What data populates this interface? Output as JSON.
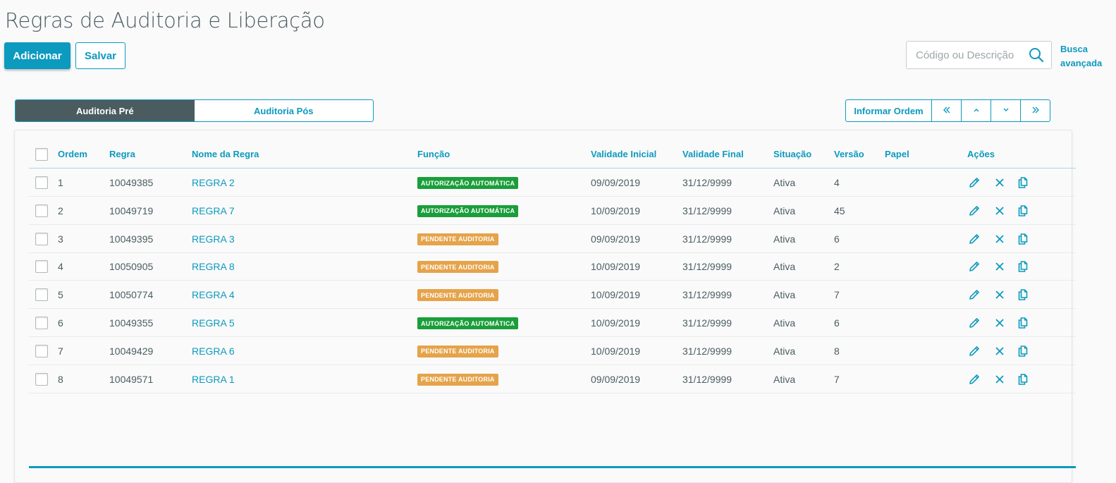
{
  "page": {
    "title": "Regras de Auditoria e Liberação"
  },
  "toolbar": {
    "add_label": "Adicionar",
    "save_label": "Salvar"
  },
  "search": {
    "placeholder": "Código ou Descrição",
    "value": "",
    "advanced_line1": "Busca",
    "advanced_line2": "avançada"
  },
  "tabs": [
    {
      "label": "Auditoria Pré",
      "active": true
    },
    {
      "label": "Auditoria Pós",
      "active": false
    }
  ],
  "order_controls": {
    "informar_label": "Informar Ordem",
    "buttons": [
      "first-icon",
      "up-icon",
      "down-icon",
      "last-icon"
    ]
  },
  "table": {
    "headers": {
      "ordem": "Ordem",
      "regra": "Regra",
      "nome": "Nome da Regra",
      "funcao": "Função",
      "validade_inicial": "Validade Inicial",
      "validade_final": "Validade Final",
      "situacao": "Situação",
      "versao": "Versão",
      "papel": "Papel",
      "acoes": "Ações"
    },
    "rows": [
      {
        "ordem": "1",
        "regra": "10049385",
        "nome": "REGRA 2",
        "funcao": "AUTORIZAÇÃO AUTOMÁTICA",
        "funcao_type": "green",
        "validade_inicial": "09/09/2019",
        "validade_final": "31/12/9999",
        "situacao": "Ativa",
        "versao": "4",
        "papel": ""
      },
      {
        "ordem": "2",
        "regra": "10049719",
        "nome": "REGRA 7",
        "funcao": "AUTORIZAÇÃO AUTOMÁTICA",
        "funcao_type": "green",
        "validade_inicial": "10/09/2019",
        "validade_final": "31/12/9999",
        "situacao": "Ativa",
        "versao": "45",
        "papel": ""
      },
      {
        "ordem": "3",
        "regra": "10049395",
        "nome": "REGRA 3",
        "funcao": "PENDENTE AUDITORIA",
        "funcao_type": "orange",
        "validade_inicial": "09/09/2019",
        "validade_final": "31/12/9999",
        "situacao": "Ativa",
        "versao": "6",
        "papel": ""
      },
      {
        "ordem": "4",
        "regra": "10050905",
        "nome": "REGRA 8",
        "funcao": "PENDENTE AUDITORIA",
        "funcao_type": "orange",
        "validade_inicial": "10/09/2019",
        "validade_final": "31/12/9999",
        "situacao": "Ativa",
        "versao": "2",
        "papel": ""
      },
      {
        "ordem": "5",
        "regra": "10050774",
        "nome": "REGRA 4",
        "funcao": "PENDENTE AUDITORIA",
        "funcao_type": "orange",
        "validade_inicial": "10/09/2019",
        "validade_final": "31/12/9999",
        "situacao": "Ativa",
        "versao": "7",
        "papel": ""
      },
      {
        "ordem": "6",
        "regra": "10049355",
        "nome": "REGRA 5",
        "funcao": "AUTORIZAÇÃO AUTOMÁTICA",
        "funcao_type": "green",
        "validade_inicial": "10/09/2019",
        "validade_final": "31/12/9999",
        "situacao": "Ativa",
        "versao": "6",
        "papel": ""
      },
      {
        "ordem": "7",
        "regra": "10049429",
        "nome": "REGRA 6",
        "funcao": "PENDENTE AUDITORIA",
        "funcao_type": "orange",
        "validade_inicial": "10/09/2019",
        "validade_final": "31/12/9999",
        "situacao": "Ativa",
        "versao": "8",
        "papel": ""
      },
      {
        "ordem": "8",
        "regra": "10049571",
        "nome": "REGRA 1",
        "funcao": "PENDENTE AUDITORIA",
        "funcao_type": "orange",
        "validade_inicial": "09/09/2019",
        "validade_final": "31/12/9999",
        "situacao": "Ativa",
        "versao": "7",
        "papel": ""
      }
    ],
    "row_actions": [
      "edit-icon",
      "delete-icon",
      "copy-icon"
    ]
  },
  "colors": {
    "accent": "#0c9abe",
    "tab_active_bg": "#4a5c60",
    "badge_green": "#1a9e3a",
    "badge_orange": "#e5a34a",
    "text": "#4a5c60"
  }
}
